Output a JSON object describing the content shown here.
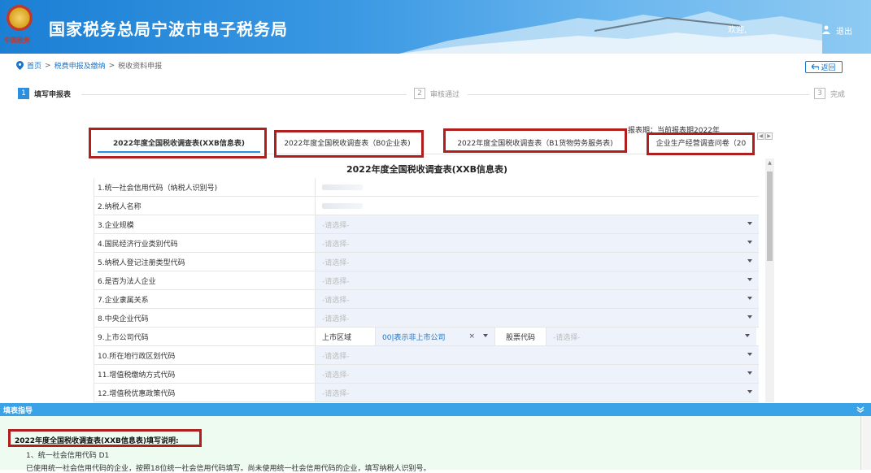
{
  "header": {
    "site_title": "国家税务总局宁波市电子税务局",
    "emblem_caption": "中国税务",
    "welcome": "欢迎,",
    "logout": "退出"
  },
  "breadcrumb": {
    "home": "首页",
    "sep1": ">",
    "level1": "税费申报及缴纳",
    "sep2": ">",
    "current": "税收资料申报"
  },
  "back_label": "返回",
  "steps": [
    {
      "num": "1",
      "label": "填写申报表"
    },
    {
      "num": "2",
      "label": "审核通过"
    },
    {
      "num": "3",
      "label": "完成"
    }
  ],
  "period_label": "报表期：当前报表期2022年",
  "tabs": [
    {
      "label": "2022年度全国税收调查表(XXB信息表)"
    },
    {
      "label": "2022年度全国税收调查表（B0企业表)"
    },
    {
      "label": "2022年度全国税收调查表（B1货物劳务服务表)"
    },
    {
      "label": "企业生产经营调查问卷（20"
    }
  ],
  "form": {
    "title": "2022年度全国税收调查表(XXB信息表)",
    "placeholder": "-请选择-",
    "rows": [
      {
        "label": "1.统一社会信用代码（纳税人识别号)",
        "type": "text"
      },
      {
        "label": "2.纳税人名称",
        "type": "text"
      },
      {
        "label": "3.企业规模",
        "type": "select"
      },
      {
        "label": "4.国民经济行业类别代码",
        "type": "select"
      },
      {
        "label": "5.纳税人登记注册类型代码",
        "type": "select"
      },
      {
        "label": "6.是否为法人企业",
        "type": "select"
      },
      {
        "label": "7.企业隶属关系",
        "type": "select"
      },
      {
        "label": "8.中央企业代码",
        "type": "select"
      },
      {
        "label": "9.上市公司代码",
        "type": "listed"
      },
      {
        "label": "10.所在地行政区划代码",
        "type": "select"
      },
      {
        "label": "11.增值税缴纳方式代码",
        "type": "select"
      },
      {
        "label": "12.增值税优惠政策代码",
        "type": "select"
      }
    ],
    "listed": {
      "region_label": "上市区域",
      "region_value": "00|表示非上市公司",
      "clear": "×",
      "stock_label": "股票代码",
      "stock_placeholder": "-请选择-"
    }
  },
  "guide": {
    "bar_label": "填表指导",
    "title": "2022年度全国税收调查表(XXB信息表)填写说明:",
    "line1": "1、统一社会信用代码 D1",
    "line2": "已使用统一社会信用代码的企业，按照18位统一社会信用代码填写。尚未使用统一社会信用代码的企业，填写纳税人识别号。"
  },
  "colors": {
    "header_blue": "#1b7fd4",
    "accent": "#2a8fe0",
    "highlight_red": "#b01e1e",
    "guide_bg": "#eefbf0"
  }
}
